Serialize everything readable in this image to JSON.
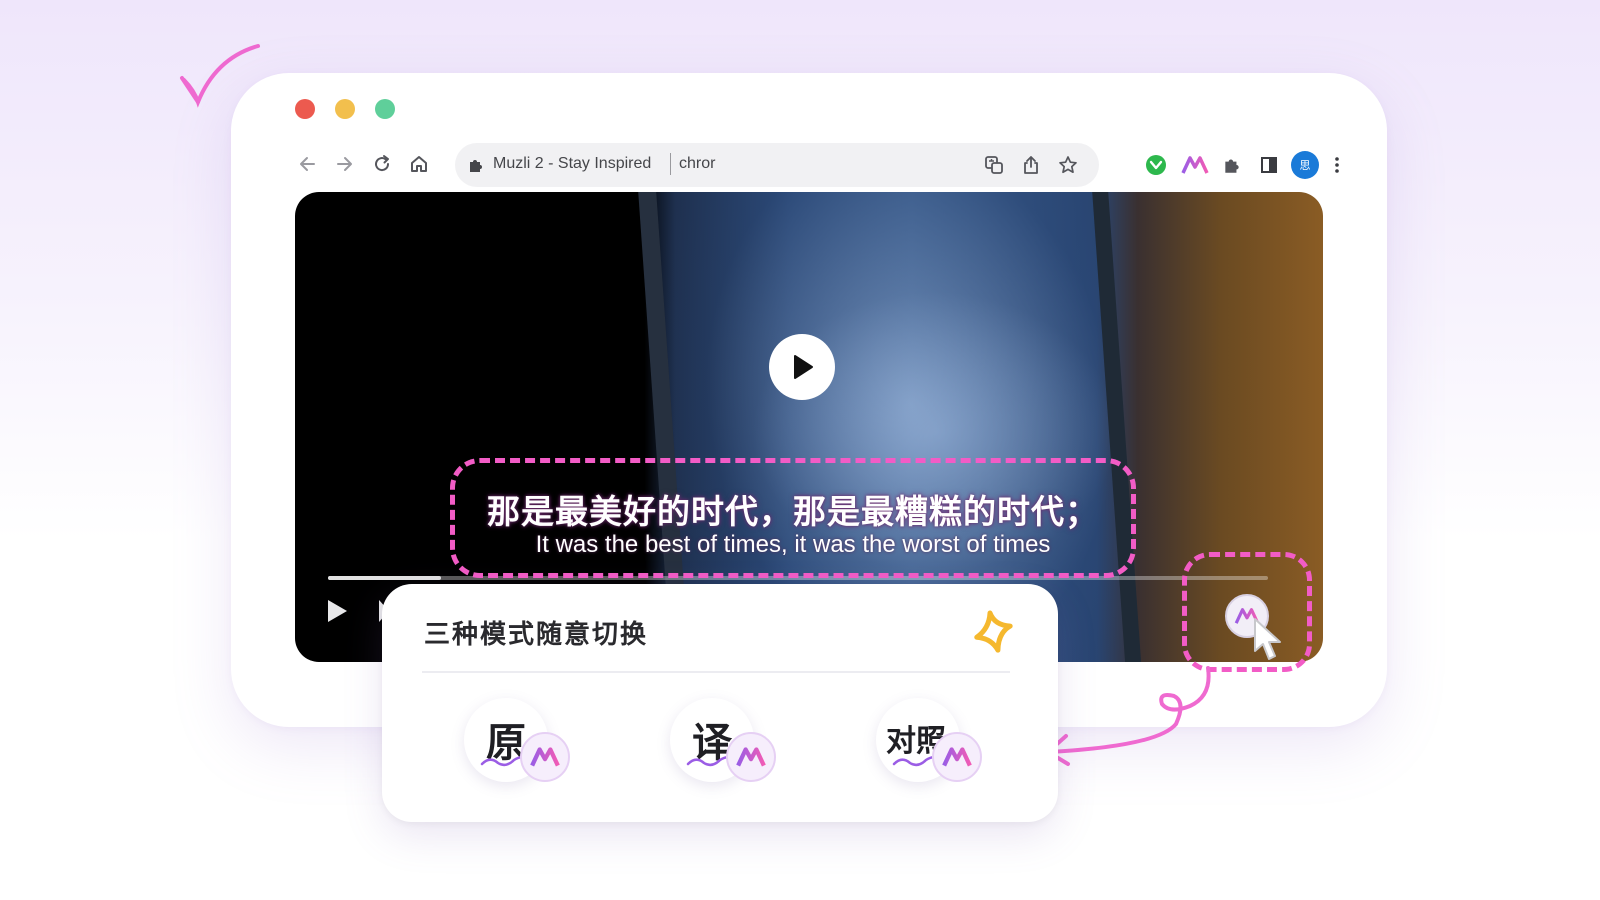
{
  "browser": {
    "tab_title": "Muzli 2 - Stay Inspired",
    "url_fragment": "chror",
    "profile_initial": "思"
  },
  "icons": {
    "back": "arrow-left-icon",
    "forward": "arrow-right-icon",
    "reload": "reload-icon",
    "home": "home-icon",
    "extension": "puzzle-icon",
    "translate": "translate-icon",
    "share": "share-icon",
    "bookmark": "star-icon",
    "more": "kebab-menu-icon"
  },
  "video": {
    "progress": 0.12
  },
  "subtitles": {
    "chinese": "那是最美好的时代，那是最糟糕的时代；",
    "english": "It was the best of times, it was the worst of times"
  },
  "mode_card": {
    "title": "三种模式随意切换",
    "modes": [
      {
        "label": "原"
      },
      {
        "label": "译"
      },
      {
        "label": "对照"
      }
    ]
  },
  "colors": {
    "highlight": "#f25cc6",
    "accent_star": "#f5b82e",
    "ai_gradient_start": "#9b5de5",
    "ai_gradient_end": "#f15bb5"
  }
}
